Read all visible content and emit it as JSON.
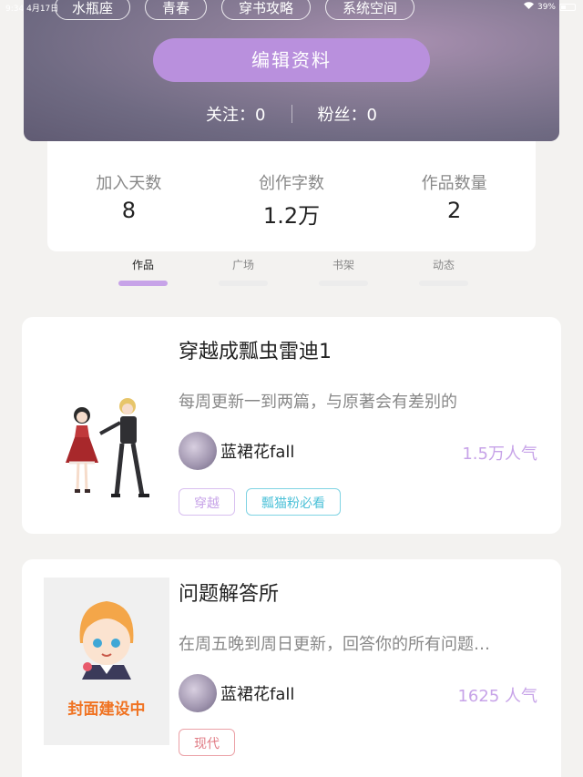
{
  "status_bar": {
    "time": "9:34",
    "date": "4月17日",
    "battery": "39%",
    "battery_level": 0.39
  },
  "header": {
    "tags": [
      "水瓶座",
      "青春",
      "穿书攻略",
      "系统空间"
    ],
    "edit_button": "编辑资料",
    "following": "关注：0",
    "followers": "粉丝：0"
  },
  "stats": [
    {
      "label": "加入天数",
      "value": "8"
    },
    {
      "label": "创作字数",
      "value": "1.2万"
    },
    {
      "label": "作品数量",
      "value": "2"
    }
  ],
  "tabs": [
    "作品",
    "广场",
    "书架",
    "动态"
  ],
  "works": [
    {
      "title": "穿越成瓢虫雷迪1",
      "description": "每周更新一到两篇，与原著会有差别的",
      "author": "蓝裙花fall",
      "popularity": "1.5万人气",
      "tags": [
        "穿越",
        "瓢猫粉必看"
      ]
    },
    {
      "title": "问题解答所",
      "description": "在周五晚到周日更新，回答你的所有问题…",
      "author": "蓝裙花fall",
      "popularity": "1625 人气",
      "cover_text": "封面建设中",
      "tags": [
        "现代"
      ]
    }
  ],
  "colors": {
    "accent": "#b990dd",
    "tag_cyan": "#4cc1d8",
    "tag_red": "#e07b84",
    "cover_text": "#f07322"
  }
}
